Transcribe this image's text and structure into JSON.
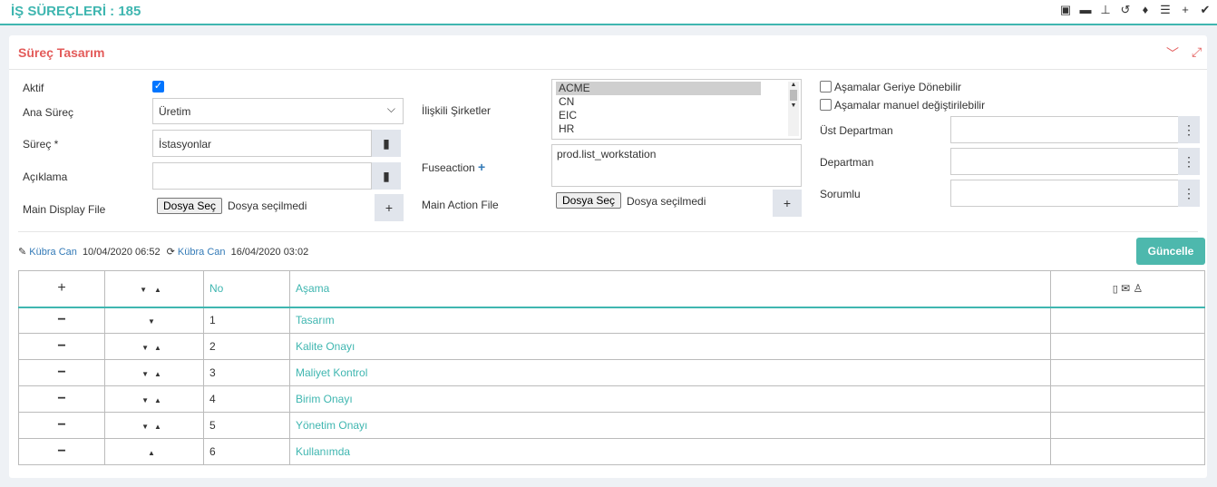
{
  "topbar": {
    "title": "İŞ SÜREÇLERİ : 185",
    "icons": [
      "layout-icon",
      "folder-icon",
      "sitemap-icon",
      "history-icon",
      "bell-icon",
      "list-icon",
      "plus-icon",
      "check-icon"
    ]
  },
  "panel": {
    "title": "Süreç Tasarım"
  },
  "form": {
    "aktif_label": "Aktif",
    "ana_surec_label": "Ana Süreç",
    "ana_surec_value": "Üretim",
    "surec_label": "Süreç *",
    "surec_value": "İstasyonlar",
    "aciklama_label": "Açıklama",
    "main_display_label": "Main Display File",
    "file_button": "Dosya Seç",
    "file_none": "Dosya seçilmedi",
    "iliskili_label": "İlişkili Şirketler",
    "companies": [
      "ACME",
      "CN",
      "EIC",
      "HR"
    ],
    "fuseaction_label": "Fuseaction",
    "fuseaction_value": "prod.list_workstation",
    "main_action_label": "Main Action File",
    "geri_label": "Aşamalar Geriye Dönebilir",
    "manuel_label": "Aşamalar manuel değiştirilebilir",
    "ust_departman_label": "Üst Departman",
    "departman_label": "Departman",
    "sorumlu_label": "Sorumlu"
  },
  "meta": {
    "editor": "Kübra Can",
    "edit_date": "10/04/2020 06:52",
    "updater": "Kübra Can",
    "update_date": "16/04/2020 03:02"
  },
  "update_button": "Güncelle",
  "table": {
    "col_no": "No",
    "col_asama": "Aşama",
    "rows": [
      {
        "no": "1",
        "name": "Tasarım",
        "arrows": "down"
      },
      {
        "no": "2",
        "name": "Kalite Onayı",
        "arrows": "both"
      },
      {
        "no": "3",
        "name": "Maliyet Kontrol",
        "arrows": "both"
      },
      {
        "no": "4",
        "name": "Birim Onayı",
        "arrows": "both"
      },
      {
        "no": "5",
        "name": "Yönetim Onayı",
        "arrows": "both"
      },
      {
        "no": "6",
        "name": "Kullanımda",
        "arrows": "up"
      }
    ]
  }
}
